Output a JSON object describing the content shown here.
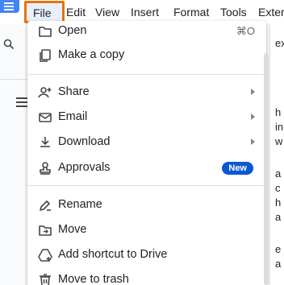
{
  "menubar": {
    "items": [
      "File",
      "Edit",
      "View",
      "Insert",
      "Format",
      "Tools",
      "Exter"
    ]
  },
  "file_menu": {
    "items": [
      {
        "label": "Open",
        "icon": "folder-icon",
        "shortcut": "⌘O"
      },
      {
        "label": "Make a copy",
        "icon": "copy-icon"
      },
      {
        "label": "Share",
        "icon": "share-person-icon",
        "submenu": true
      },
      {
        "label": "Email",
        "icon": "mail-icon",
        "submenu": true
      },
      {
        "label": "Download",
        "icon": "download-icon",
        "submenu": true
      },
      {
        "label": "Approvals",
        "icon": "approval-stamp-icon",
        "badge": "New"
      },
      {
        "label": "Rename",
        "icon": "rename-pencil-icon"
      },
      {
        "label": "Move",
        "icon": "move-folder-icon"
      },
      {
        "label": "Add shortcut to Drive",
        "icon": "add-drive-shortcut-icon"
      },
      {
        "label": "Move to trash",
        "icon": "trash-icon"
      }
    ]
  },
  "background": {
    "doc_fragments": [
      "ex",
      "h",
      "in",
      "w",
      "a",
      "c",
      "h",
      "a",
      "e",
      "a"
    ]
  },
  "colors": {
    "highlight_border": "#e8710a",
    "badge": "#0b57d0",
    "logo": "#4285f4"
  }
}
